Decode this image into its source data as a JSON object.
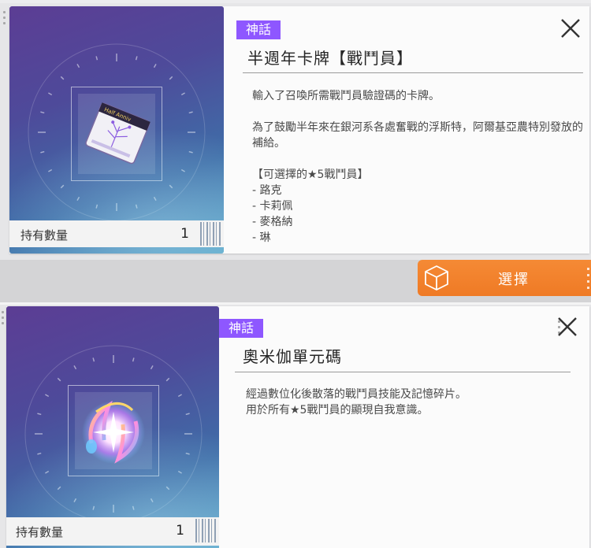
{
  "panels": [
    {
      "rarity": "神話",
      "title": "半週年卡牌【戰鬥員】",
      "description": "輸入了召喚所需戰鬥員驗證碼的卡牌。\n\n為了鼓勵半年來在銀河系各處奮戰的浮斯特，阿爾基亞農特別發放的補給。\n\n【可選擇的★5戰鬥員】\n - 路克\n - 卡莉佩\n - 麥格納\n - 琳",
      "quantity_label": "持有數量",
      "quantity": "1",
      "icon": "half-anniversary-card-icon",
      "card_print": "Half Anniv"
    },
    {
      "rarity": "神話",
      "title": "奧米伽單元碼",
      "description": "經過數位化後散落的戰鬥員技能及記憶碎片。\n用於所有★5戰鬥員的顯現自我意識。",
      "quantity_label": "持有數量",
      "quantity": "1",
      "icon": "omega-unit-code-icon"
    }
  ],
  "select_button": {
    "label": "選擇",
    "icon": "cube-icon"
  },
  "colors": {
    "rarity_badge": "#8e57ff",
    "select_button": "#f07d28",
    "art_bg": "#4e4a9a"
  }
}
